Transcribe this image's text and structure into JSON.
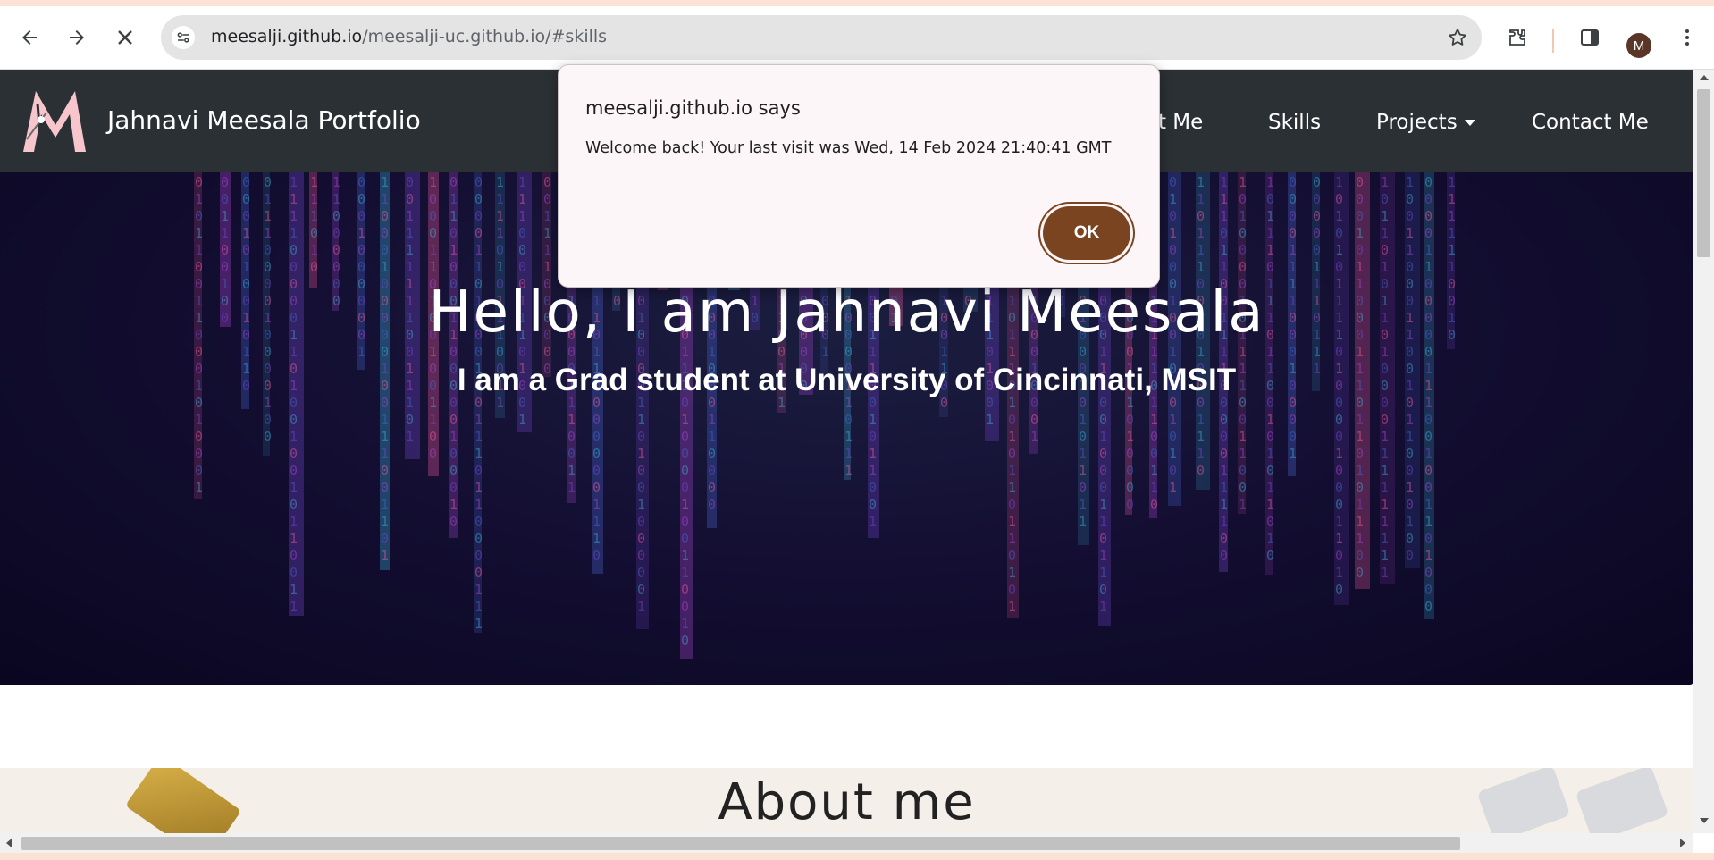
{
  "browser": {
    "url_host": "meesalji.github.io",
    "url_path": "/meesalji-uc.github.io/#skills",
    "profile_initial": "M"
  },
  "navbar": {
    "brand": "Jahnavi Meesala Portfolio",
    "links": [
      "About Me",
      "Skills",
      "Projects",
      "Contact Me"
    ]
  },
  "hero": {
    "title": "Hello, I am Jahnavi Meesala",
    "subtitle": "I am a Grad student at University of Cincinnati, MSIT"
  },
  "about": {
    "title": "About me"
  },
  "dialog": {
    "title": "meesalji.github.io says",
    "message": "Welcome back! Your last visit was Wed, 14 Feb 2024 21:40:41 GMT",
    "ok_label": "OK"
  },
  "colors": {
    "navbar_bg": "#2b3035",
    "ok_button": "#7a4420",
    "logo_pink": "#f6c6cc"
  }
}
